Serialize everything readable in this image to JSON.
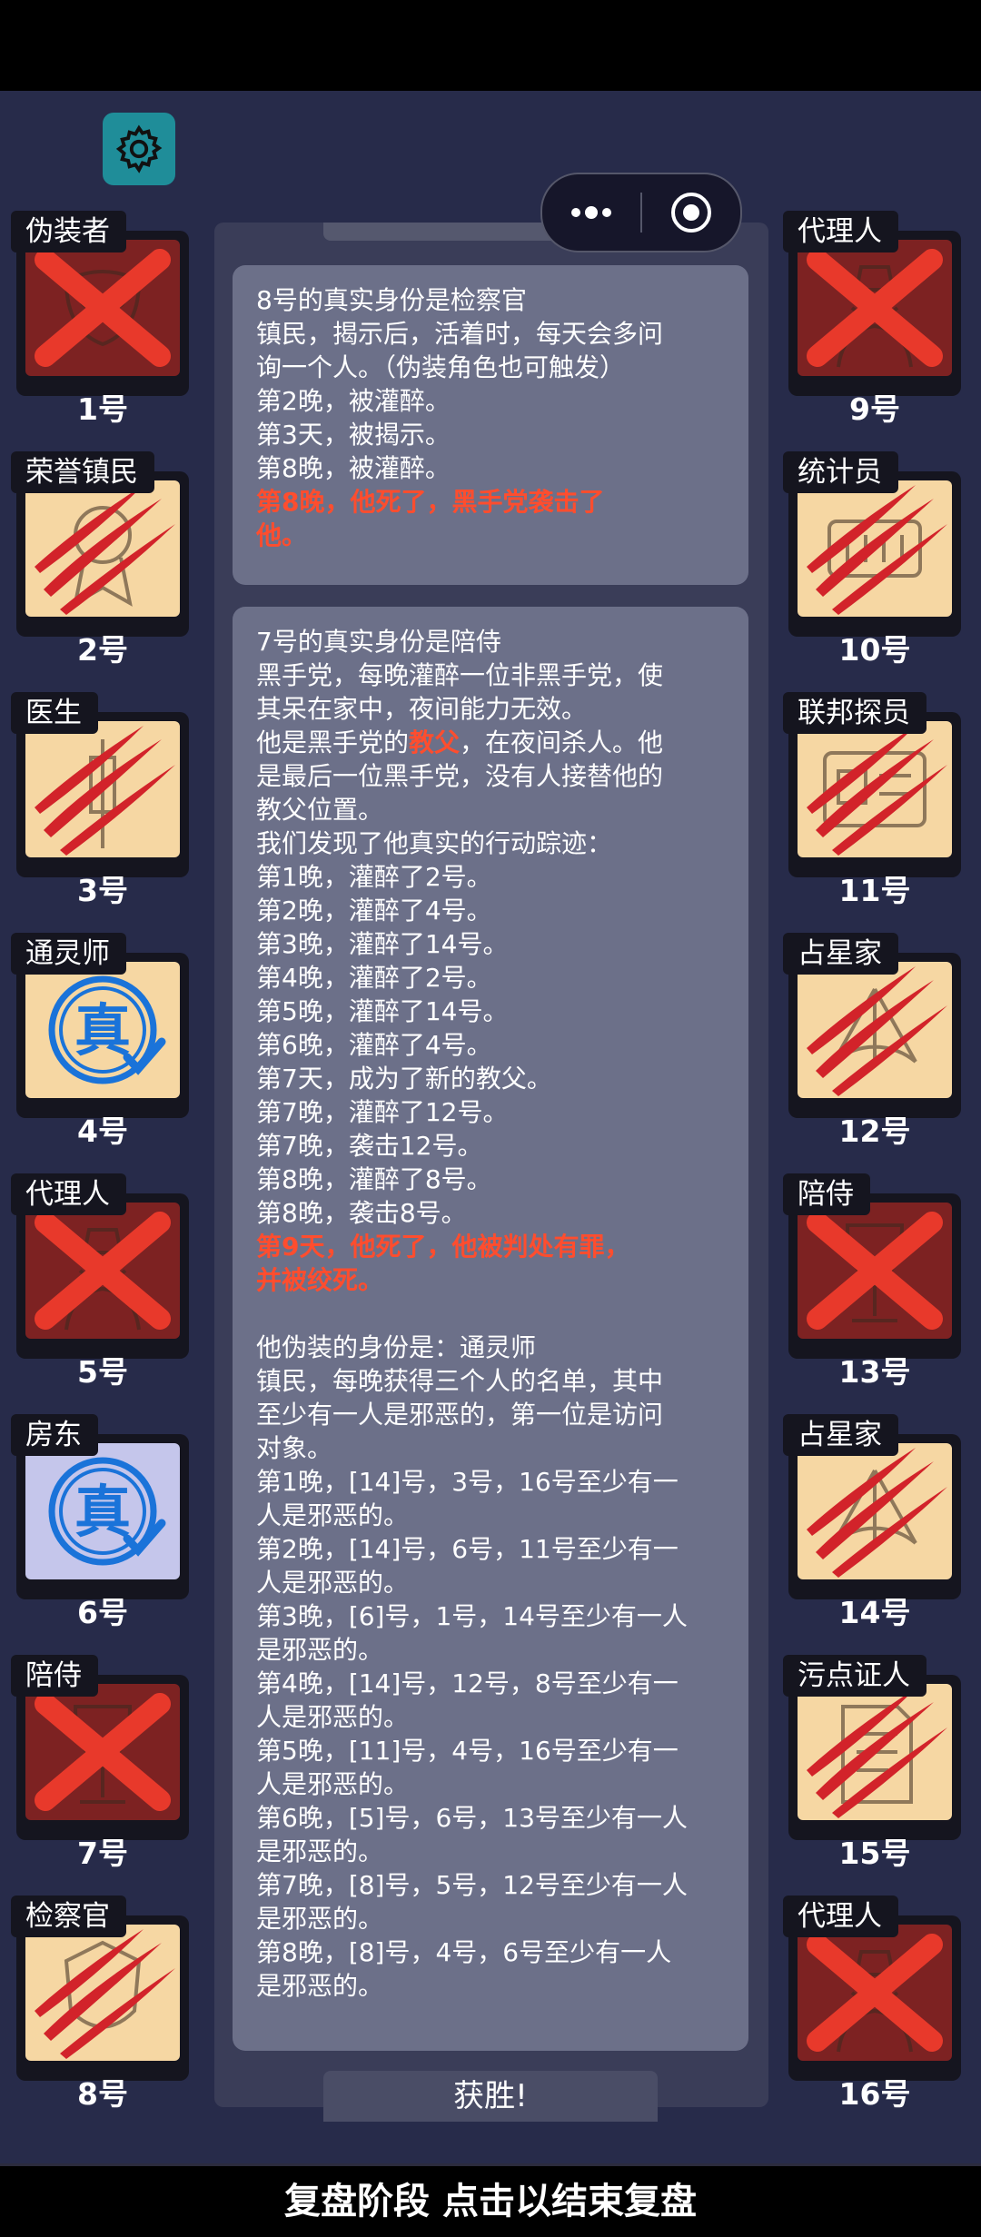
{
  "header": {
    "settings_icon": "gear-icon",
    "menu_icon": "more-dots-icon",
    "target_icon": "record-target-icon"
  },
  "players_left": [
    {
      "role": "伪装者",
      "number": "1号",
      "state": "dead",
      "icon": "mask-icon"
    },
    {
      "role": "荣誉镇民",
      "number": "2号",
      "state": "clawed",
      "icon": "medal-icon"
    },
    {
      "role": "医生",
      "number": "3号",
      "state": "clawed",
      "icon": "syringe-icon"
    },
    {
      "role": "通灵师",
      "number": "4号",
      "state": "true",
      "icon": "true-stamp-icon",
      "stamp": "真"
    },
    {
      "role": "代理人",
      "number": "5号",
      "state": "dead",
      "icon": "hat-figure-icon"
    },
    {
      "role": "房东",
      "number": "6号",
      "state": "true-blue",
      "icon": "true-stamp-icon",
      "stamp": "真"
    },
    {
      "role": "陪侍",
      "number": "7号",
      "state": "dead",
      "icon": "glass-icon"
    },
    {
      "role": "检察官",
      "number": "8号",
      "state": "clawed",
      "icon": "badge-icon"
    }
  ],
  "players_right": [
    {
      "role": "代理人",
      "number": "9号",
      "state": "dead",
      "icon": "hat-figure-icon"
    },
    {
      "role": "统计员",
      "number": "10号",
      "state": "clawed",
      "icon": "counter-icon"
    },
    {
      "role": "联邦探员",
      "number": "11号",
      "state": "clawed",
      "icon": "id-card-icon"
    },
    {
      "role": "占星家",
      "number": "12号",
      "state": "clawed",
      "icon": "sextant-icon"
    },
    {
      "role": "陪侍",
      "number": "13号",
      "state": "dead",
      "icon": "glass-icon"
    },
    {
      "role": "占星家",
      "number": "14号",
      "state": "clawed",
      "icon": "sextant-icon"
    },
    {
      "role": "污点证人",
      "number": "15号",
      "state": "clawed",
      "icon": "document-icon"
    },
    {
      "role": "代理人",
      "number": "16号",
      "state": "dead",
      "icon": "hat-figure-icon"
    }
  ],
  "message1": {
    "lines": [
      "8号的真实身份是检察官",
      "镇民，揭示后，活着时，每天会多问",
      "询一个人。（伪装角色也可触发）",
      "第2晚，被灌醉。",
      "第3天，被揭示。",
      "第8晚，被灌醉。"
    ],
    "death_lines": [
      "第8晚，他死了，黑手党袭击了",
      "他。"
    ]
  },
  "message2": {
    "lines_a": [
      "7号的真实身份是陪侍",
      "黑手党，每晚灌醉一位非黑手党，使",
      "其呆在家中，夜间能力无效。"
    ],
    "godfather_prefix": "他是黑手党的",
    "godfather_word": "教父",
    "godfather_suffix": "，在夜间杀人。他",
    "lines_b": [
      "是最后一位黑手党，没有人接替他的",
      "教父位置。",
      "我们发现了他真实的行动踪迹：",
      "第1晚，灌醉了2号。",
      "第2晚，灌醉了4号。",
      "第3晚，灌醉了14号。",
      "第4晚，灌醉了2号。",
      "第5晚，灌醉了14号。",
      "第6晚，灌醉了4号。",
      "第7天，成为了新的教父。",
      "第7晚，灌醉了12号。",
      "第7晚，袭击12号。",
      "第8晚，灌醉了8号。",
      "第8晚，袭击8号。"
    ],
    "death_lines": [
      "第9天，他死了，他被判处有罪，",
      "并被绞死。"
    ],
    "lines_c": [
      "",
      "他伪装的身份是：通灵师",
      "镇民，每晚获得三个人的名单，其中",
      "至少有一人是邪恶的，第一位是访问",
      "对象。",
      "第1晚，[14]号，3号，16号至少有一",
      "人是邪恶的。",
      "第2晚，[14]号，6号，11号至少有一",
      "人是邪恶的。",
      "第3晚，[6]号，1号，14号至少有一人",
      "是邪恶的。",
      "第4晚，[14]号，12号，8号至少有一",
      "人是邪恶的。",
      "第5晚，[11]号，4号，16号至少有一",
      "人是邪恶的。",
      "第6晚，[5]号，6号，13号至少有一人",
      "是邪恶的。",
      "第7晚，[8]号，5号，12号至少有一人",
      "是邪恶的。",
      "第8晚，[8]号，4号，6号至少有一人",
      "是邪恶的。"
    ]
  },
  "victory_label": "获胜!",
  "bottom_bar_label": "复盘阶段 点击以结束复盘",
  "colors": {
    "background": "#272b4a",
    "dead": "#7d2222",
    "alive": "#f6d7a3",
    "cross": "#e8392b",
    "highlight": "#ff4d2e",
    "true_stamp": "#1a73d9"
  }
}
